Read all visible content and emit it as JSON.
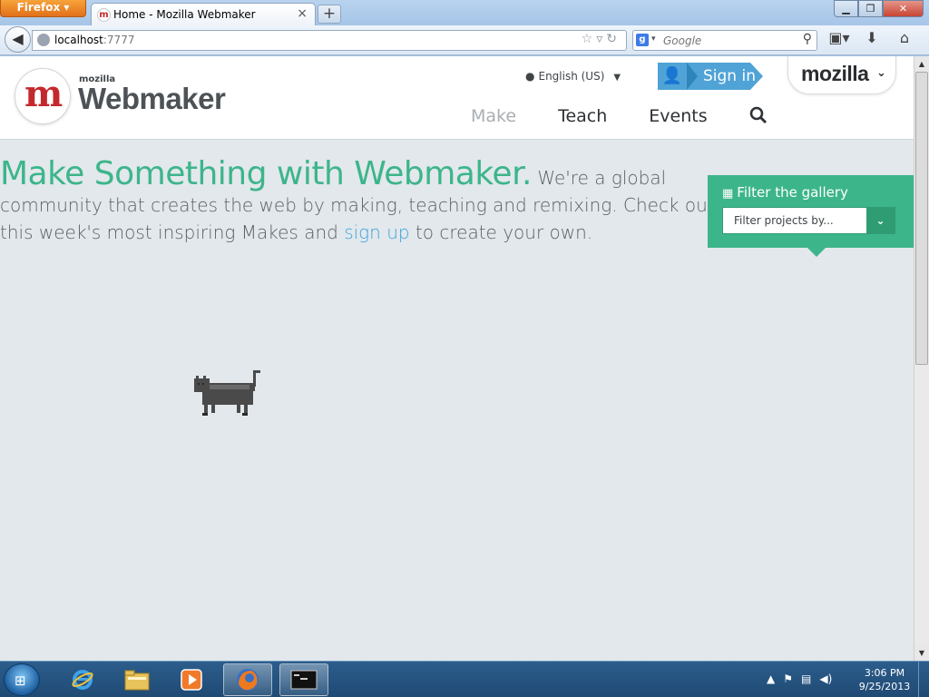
{
  "browser": {
    "menu_label": "Firefox ▾",
    "tab": {
      "title": "Home - Mozilla Webmaker",
      "favicon_text": "m"
    },
    "new_tab_symbol": "+",
    "url": {
      "host": "localhost",
      "port": ":7777"
    },
    "search": {
      "engine_badge": "g",
      "placeholder": "Google"
    }
  },
  "site": {
    "logo": {
      "mark": "m",
      "small": "mozilla",
      "word": "Webmaker"
    },
    "language": "English (US)",
    "signin_label": "Sign in",
    "mozilla_label": "mozilla",
    "nav": {
      "make": "Make",
      "teach": "Teach",
      "events": "Events"
    },
    "hero": {
      "title": "Make Something with Webmaker.",
      "line1": "We're a global",
      "line2": "community that creates the web by making, teaching and remixing. Check out",
      "line3_a": "this week's most inspiring Makes and",
      "line3_link": "sign up",
      "line3_b": "to create your own."
    },
    "filter": {
      "title": "Filter the gallery",
      "select_text": "Filter projects by..."
    }
  },
  "taskbar": {
    "clock_time": "3:06 PM",
    "clock_date": "9/25/2013"
  },
  "colors": {
    "accent_green": "#3db58a",
    "signin_blue": "#4fa3d6",
    "link_blue": "#3fa3d8",
    "logo_red": "#c4282c"
  }
}
